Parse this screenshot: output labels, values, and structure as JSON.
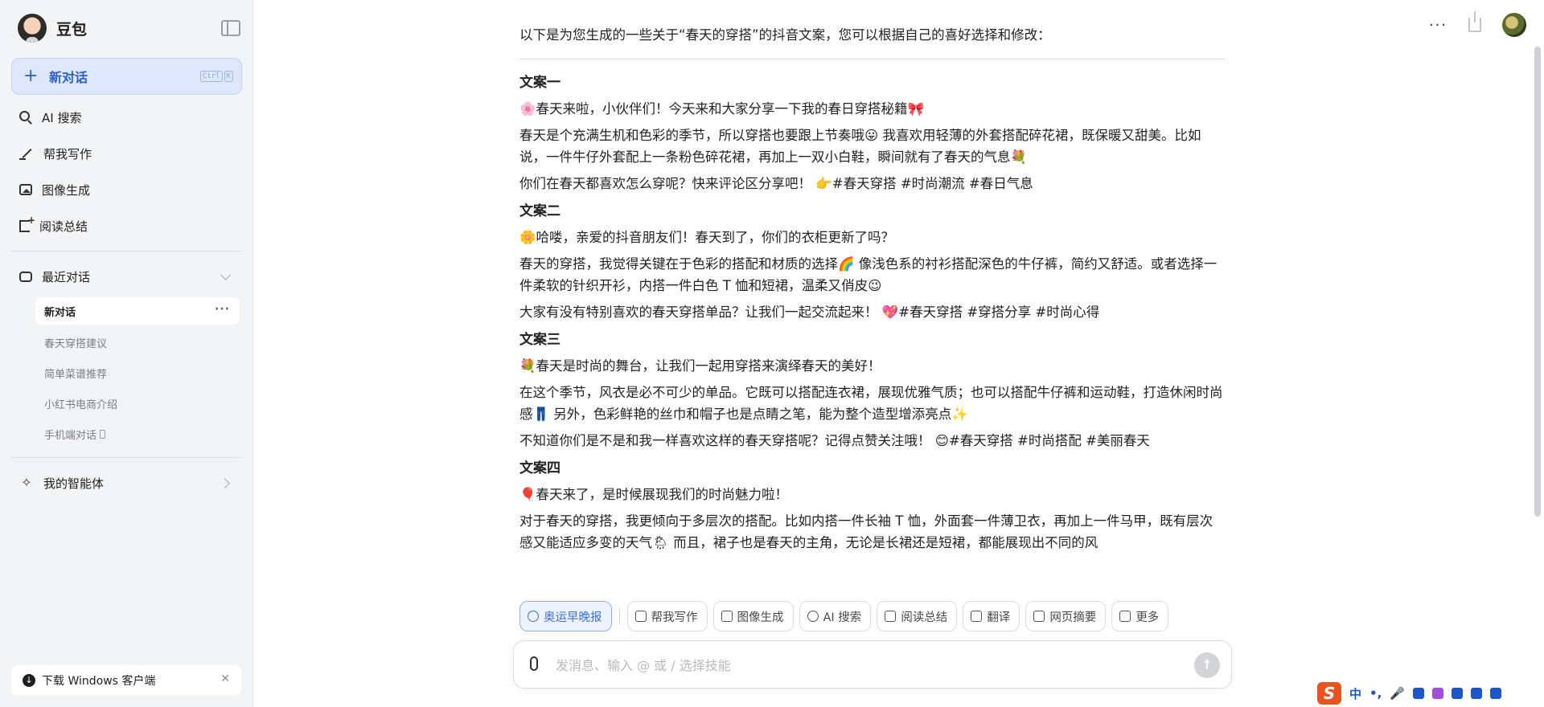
{
  "sidebar": {
    "brand": "豆包",
    "new_chat": {
      "label": "新对话",
      "shortcut": [
        "Ctrl",
        "K"
      ]
    },
    "nav": [
      {
        "label": "AI 搜索",
        "icon": "ai-search-icon"
      },
      {
        "label": "帮我写作",
        "icon": "pen-icon"
      },
      {
        "label": "图像生成",
        "icon": "image-icon"
      },
      {
        "label": "阅读总结",
        "icon": "read-summary-icon"
      }
    ],
    "recent_label": "最近对话",
    "history": [
      {
        "label": "新对话",
        "active": true
      },
      {
        "label": "春天穿搭建议"
      },
      {
        "label": "简单菜谱推荐"
      },
      {
        "label": "小红书电商介绍"
      },
      {
        "label": "手机端对话"
      }
    ],
    "agents_label": "我的智能体",
    "download": "下载 Windows 客户端"
  },
  "main": {
    "intro": "以下是为您生成的一些关于“春天的穿搭”的抖音文案，您可以根据自己的喜好选择和修改：",
    "sections": [
      {
        "title": "文案一",
        "paragraphs": [
          "🌸春天来啦，小伙伴们！今天来和大家分享一下我的春日穿搭秘籍🎀",
          "春天是个充满生机和色彩的季节，所以穿搭也要跟上节奏哦😛 我喜欢用轻薄的外套搭配碎花裙，既保暖又甜美。比如说，一件牛仔外套配上一条粉色碎花裙，再加上一双小白鞋，瞬间就有了春天的气息💐",
          "你们在春天都喜欢怎么穿呢？快来评论区分享吧！ 👉#春天穿搭 #时尚潮流 #春日气息"
        ]
      },
      {
        "title": "文案二",
        "paragraphs": [
          "🌼哈喽，亲爱的抖音朋友们！春天到了，你们的衣柜更新了吗？",
          "春天的穿搭，我觉得关键在于色彩的搭配和材质的选择🌈 像浅色系的衬衫搭配深色的牛仔裤，简约又舒适。或者选择一件柔软的针织开衫，内搭一件白色 T 恤和短裙，温柔又俏皮😉",
          "大家有没有特别喜欢的春天穿搭单品？让我们一起交流起来！ 💖#春天穿搭 #穿搭分享 #时尚心得"
        ]
      },
      {
        "title": "文案三",
        "paragraphs": [
          "💐春天是时尚的舞台，让我们一起用穿搭来演绎春天的美好！",
          "在这个季节，风衣是必不可少的单品。它既可以搭配连衣裙，展现优雅气质；也可以搭配牛仔裤和运动鞋，打造休闲时尚感👖 另外，色彩鲜艳的丝巾和帽子也是点睛之笔，能为整个造型增添亮点✨",
          "不知道你们是不是和我一样喜欢这样的春天穿搭呢？记得点赞关注哦！ 😊#春天穿搭 #时尚搭配 #美丽春天"
        ]
      },
      {
        "title": "文案四",
        "paragraphs": [
          "🎈春天来了，是时候展现我们的时尚魅力啦！",
          "对于春天的穿搭，我更倾向于多层次的搭配。比如内搭一件长袖 T 恤，外面套一件薄卫衣，再加上一件马甲，既有层次感又能适应多变的天气🌦 而且，裙子也是春天的主角，无论是长裙还是短裙，都能展现出不同的风"
        ]
      }
    ],
    "chips": [
      {
        "label": "奥运早晚报",
        "active": true
      },
      {
        "label": "帮我写作"
      },
      {
        "label": "图像生成"
      },
      {
        "label": "AI 搜索"
      },
      {
        "label": "阅读总结"
      },
      {
        "label": "翻译"
      },
      {
        "label": "网页摘要"
      },
      {
        "label": "更多"
      }
    ],
    "input_placeholder": "发消息、输入 @ 或 / 选择技能"
  },
  "ime": {
    "logo": "S",
    "mode": "中",
    "punct": "•,"
  },
  "colors": {
    "accent": "#2b5fd1",
    "sidebar_bg": "#f3f4f6",
    "ime_brand": "#e8541e"
  }
}
